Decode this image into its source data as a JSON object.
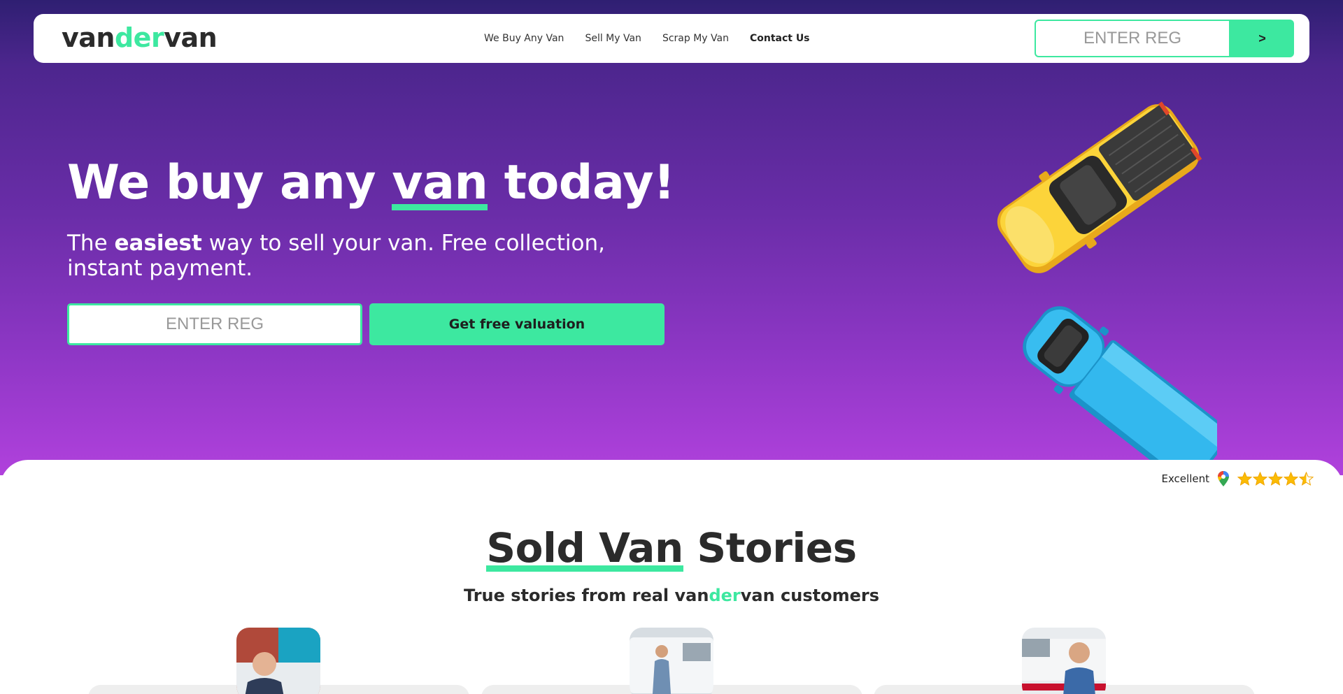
{
  "nav": {
    "logo": {
      "part1": "van",
      "part2": "der",
      "part3": "van"
    },
    "links": [
      {
        "label": "We Buy Any Van"
      },
      {
        "label": "Sell My Van"
      },
      {
        "label": "Scrap My Van"
      },
      {
        "label": "Contact Us"
      }
    ],
    "reg_placeholder": "ENTER REG",
    "go_label": ">"
  },
  "hero": {
    "title_before": "We buy any ",
    "title_highlight": "van",
    "title_after": " today!",
    "subtitle_before": "The ",
    "subtitle_bold": "easiest",
    "subtitle_after": " way to sell your van. Free collection, instant payment.",
    "reg_placeholder": "ENTER REG",
    "cta_label": "Get free valuation"
  },
  "rating": {
    "label": "Excellent",
    "value": 4.5,
    "max": 5,
    "icon": "google-maps-pin-icon"
  },
  "stories": {
    "title_highlight": "Sold Van",
    "title_rest": " Stories",
    "subtitle_before": "True stories from real ",
    "subtitle_brand1": "van",
    "subtitle_brand2": "der",
    "subtitle_brand3": "van",
    "subtitle_after": " customers"
  },
  "colors": {
    "accent": "#3de8a0",
    "hero_top": "#2f1f72",
    "hero_bottom": "#b041dc",
    "text_dark": "#2b2b2b"
  }
}
